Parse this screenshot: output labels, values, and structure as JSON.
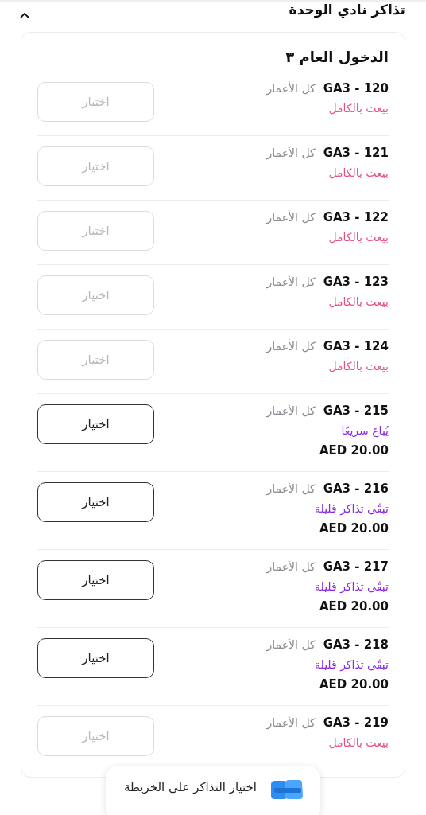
{
  "header": {
    "title": "تذاكر نادي الوحدة",
    "expanded": true
  },
  "section": {
    "title": "الدخول العام ٣",
    "rows": [
      {
        "code": "GA3 - 120",
        "age": "كل الأعمار",
        "status": "بيعت بالكامل",
        "kind": "sold_out",
        "button": "اختيار",
        "disabled": true
      },
      {
        "code": "GA3 - 121",
        "age": "كل الأعمار",
        "status": "بيعت بالكامل",
        "kind": "sold_out",
        "button": "اختيار",
        "disabled": true
      },
      {
        "code": "GA3 - 122",
        "age": "كل الأعمار",
        "status": "بيعت بالكامل",
        "kind": "sold_out",
        "button": "اختيار",
        "disabled": true
      },
      {
        "code": "GA3 - 123",
        "age": "كل الأعمار",
        "status": "بيعت بالكامل",
        "kind": "sold_out",
        "button": "اختيار",
        "disabled": true
      },
      {
        "code": "GA3 - 124",
        "age": "كل الأعمار",
        "status": "بيعت بالكامل",
        "kind": "sold_out",
        "button": "اختيار",
        "disabled": true
      },
      {
        "code": "GA3 - 215",
        "age": "كل الأعمار",
        "status": "يُباع سريعًا",
        "kind": "available",
        "price": "AED 20.00",
        "button": "اختيار",
        "disabled": false
      },
      {
        "code": "GA3 - 216",
        "age": "كل الأعمار",
        "status": "تبقّى تذاكر قليلة",
        "kind": "available",
        "price": "AED 20.00",
        "button": "اختيار",
        "disabled": false
      },
      {
        "code": "GA3 - 217",
        "age": "كل الأعمار",
        "status": "تبقّى تذاكر قليلة",
        "kind": "available",
        "price": "AED 20.00",
        "button": "اختيار",
        "disabled": false
      },
      {
        "code": "GA3 - 218",
        "age": "كل الأعمار",
        "status": "تبقّى تذاكر قليلة",
        "kind": "available",
        "price": "AED 20.00",
        "button": "اختيار",
        "disabled": false
      },
      {
        "code": "GA3 - 219",
        "age": "كل الأعمار",
        "status": "بيعت بالكامل",
        "kind": "sold_out",
        "button": "اختيار",
        "disabled": true
      }
    ]
  },
  "map_button": {
    "label": "اختيار التذاكر على الخريطة"
  }
}
